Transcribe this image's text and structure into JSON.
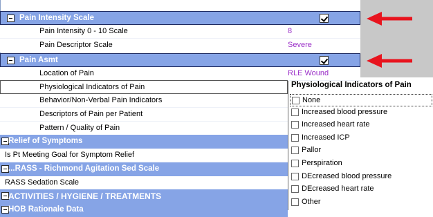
{
  "sections": {
    "pain_intensity": {
      "title": "Pain Intensity Scale",
      "checked": true
    },
    "pain_asmt": {
      "title": "Pain Asmt",
      "checked": true
    },
    "relief": {
      "title": "Relief of Symptoms"
    },
    "rass": {
      "title": "...RASS - Richmond Agitation Sed Scale"
    },
    "activities": {
      "title": "ACTIVITIES / HYGIENE / TREATMENTS"
    },
    "hob": {
      "title": "HOB Rationale Data"
    }
  },
  "rows": {
    "pain_intensity_0_10": {
      "label": "Pain Intensity 0 - 10 Scale",
      "value": "8"
    },
    "pain_descriptor": {
      "label": "Pain Descriptor Scale",
      "value": "Severe"
    },
    "location": {
      "label": "Location of Pain",
      "value": "RLE Wound"
    },
    "physiological": {
      "label": "Physiological Indicators of Pain"
    },
    "behavior": {
      "label": "Behavior/Non-Verbal Pain Indicators"
    },
    "descriptors": {
      "label": "Descriptors of Pain per Patient"
    },
    "pattern": {
      "label": "Pattern / Quality of Pain"
    },
    "goal": {
      "label": "Is Pt Meeting Goal for Symptom Relief"
    },
    "rass_scale": {
      "label": "RASS Sedation Scale"
    }
  },
  "popup": {
    "title": "Physiological Indicators of Pain",
    "options": [
      "None",
      "Increased blood pressure",
      "Increased heart rate",
      "Increased ICP",
      "Pallor",
      "Perspiration",
      "DEcreased blood pressure",
      "DEcreased heart rate",
      "Other"
    ]
  },
  "colors": {
    "section_bg": "#86a4e6",
    "value_text": "#9b30c8",
    "arrow": "#e8141e"
  }
}
